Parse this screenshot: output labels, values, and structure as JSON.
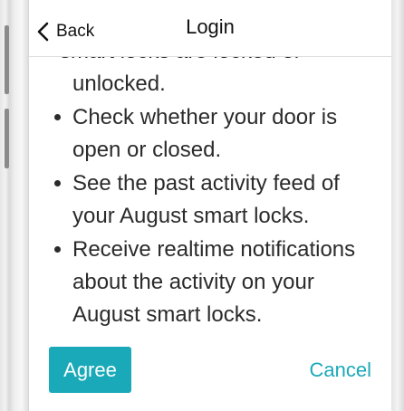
{
  "nav": {
    "back_label": "Back",
    "title": "Login"
  },
  "content": {
    "partial_line": "smart locks are locked or",
    "lines": [
      "unlocked.",
      "Check whether your door is",
      "open or closed.",
      "See the past activity feed of",
      "your August smart locks.",
      "Receive realtime notifications",
      "about the activity on your",
      "August smart locks."
    ]
  },
  "actions": {
    "agree_label": "Agree",
    "cancel_label": "Cancel"
  },
  "colors": {
    "accent": "#1aa9b8",
    "text": "#2b2b2b"
  }
}
